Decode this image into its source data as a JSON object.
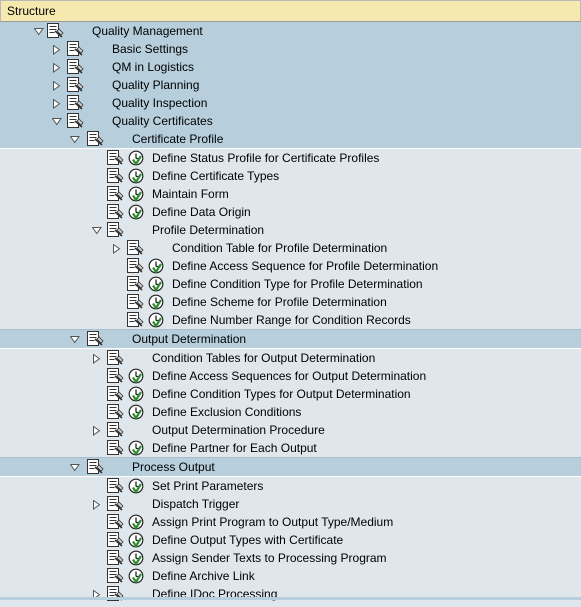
{
  "header": {
    "title": "Structure"
  },
  "colors": {
    "header_bg": "#f6e9b0",
    "row_blue": "#b7cfdc",
    "row_grey": "#dfe6ec",
    "clock_green": "#2e8b2e"
  },
  "icons": {
    "expander": "triangle-icon",
    "node": "document-node-icon",
    "activity": "clock-execute-icon"
  },
  "tree": [
    {
      "label": "Quality Management",
      "level": 0,
      "toggle": "open",
      "clock": false
    },
    {
      "label": "Basic Settings",
      "level": 1,
      "toggle": "closed",
      "clock": false
    },
    {
      "label": "QM in Logistics",
      "level": 1,
      "toggle": "closed",
      "clock": false
    },
    {
      "label": "Quality Planning",
      "level": 1,
      "toggle": "closed",
      "clock": false
    },
    {
      "label": "Quality Inspection",
      "level": 1,
      "toggle": "closed",
      "clock": false
    },
    {
      "label": "Quality Certificates",
      "level": 1,
      "toggle": "open",
      "clock": false
    },
    {
      "label": "Certificate Profile",
      "level": 2,
      "toggle": "open",
      "clock": false
    },
    {
      "label": "Define Status Profile for Certificate Profiles",
      "level": 3,
      "toggle": "none",
      "clock": true
    },
    {
      "label": "Define Certificate Types",
      "level": 3,
      "toggle": "none",
      "clock": true
    },
    {
      "label": "Maintain Form",
      "level": 3,
      "toggle": "none",
      "clock": true
    },
    {
      "label": "Define Data Origin",
      "level": 3,
      "toggle": "none",
      "clock": true
    },
    {
      "label": "Profile Determination",
      "level": 3,
      "toggle": "open",
      "clock": false
    },
    {
      "label": "Condition Table for Profile Determination",
      "level": 4,
      "toggle": "closed",
      "clock": false
    },
    {
      "label": "Define Access Sequence for Profile Determination",
      "level": 4,
      "toggle": "none",
      "clock": true
    },
    {
      "label": "Define Condition Type for Profile Determination",
      "level": 4,
      "toggle": "none",
      "clock": true
    },
    {
      "label": "Define Scheme for Profile Determination",
      "level": 4,
      "toggle": "none",
      "clock": true
    },
    {
      "label": "Define Number Range for Condition Records",
      "level": 4,
      "toggle": "none",
      "clock": true
    },
    {
      "label": "Output Determination",
      "level": 2,
      "toggle": "open",
      "clock": false
    },
    {
      "label": "Condition Tables for Output Determination",
      "level": 3,
      "toggle": "closed",
      "clock": false
    },
    {
      "label": "Define Access Sequences for Output Determination",
      "level": 3,
      "toggle": "none",
      "clock": true
    },
    {
      "label": "Define Condition Types for Output Determination",
      "level": 3,
      "toggle": "none",
      "clock": true
    },
    {
      "label": "Define Exclusion Conditions",
      "level": 3,
      "toggle": "none",
      "clock": true
    },
    {
      "label": "Output Determination Procedure",
      "level": 3,
      "toggle": "closed",
      "clock": false
    },
    {
      "label": "Define Partner for Each Output",
      "level": 3,
      "toggle": "none",
      "clock": true
    },
    {
      "label": "Process Output",
      "level": 2,
      "toggle": "open",
      "clock": false
    },
    {
      "label": "Set Print Parameters",
      "level": 3,
      "toggle": "none",
      "clock": true
    },
    {
      "label": "Dispatch Trigger",
      "level": 3,
      "toggle": "closed",
      "clock": false
    },
    {
      "label": "Assign Print Program to Output Type/Medium",
      "level": 3,
      "toggle": "none",
      "clock": true
    },
    {
      "label": "Define Output Types with Certificate",
      "level": 3,
      "toggle": "none",
      "clock": true
    },
    {
      "label": "Assign Sender Texts to Processing Program",
      "level": 3,
      "toggle": "none",
      "clock": true
    },
    {
      "label": "Define Archive Link",
      "level": 3,
      "toggle": "none",
      "clock": true
    },
    {
      "label": "Define IDoc Processing",
      "level": 3,
      "toggle": "closed",
      "clock": false
    }
  ]
}
